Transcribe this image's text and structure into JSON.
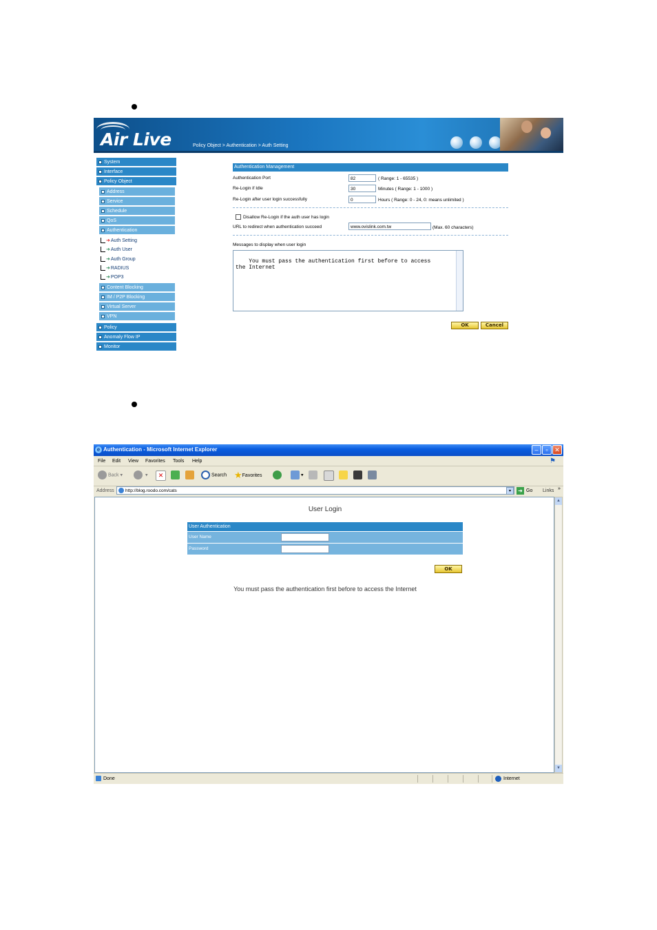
{
  "router_ui": {
    "logo": "Air Live",
    "breadcrumb": "Policy Object > Authentication > Auth Setting",
    "nav": {
      "system": "System",
      "interface": "Interface",
      "policy_object": "Policy Object",
      "address": "Address",
      "service": "Service",
      "schedule": "Schedule",
      "qos": "QoS",
      "authentication": "Authentication",
      "auth_setting": "Auth Setting",
      "auth_user": "Auth User",
      "auth_group": "Auth Group",
      "radius": "RADIUS",
      "pop3": "POP3",
      "content_blocking": "Content Blocking",
      "im_p2p_blocking": "IM / P2P Blocking",
      "virtual_server": "Virtual Server",
      "vpn": "VPN",
      "policy": "Policy",
      "anomaly_flow_ip": "Anomaly Flow IP",
      "monitor": "Monitor"
    },
    "section_title": "Authentication Management",
    "fields": {
      "auth_port_label": "Authentication Port",
      "auth_port_value": "82",
      "auth_port_hint": "( Range: 1 - 65535 )",
      "relogin_idle_label": "Re-Login if Idle",
      "relogin_idle_value": "30",
      "relogin_idle_hint": "Minutes  ( Range: 1 - 1000 )",
      "relogin_after_label": "Re-Login after user login successfully",
      "relogin_after_value": "0",
      "relogin_after_hint": "Hours  ( Range: 0 - 24, 0: means unlimited )",
      "disallow_label": "Disallow Re-Login if the auth user has login",
      "redirect_label": "URL to redirect when authentication succeed",
      "redirect_value": "www.ovislink.com.tw",
      "redirect_hint": "(Max. 60 characters)",
      "message_label": "Messages to display when user login",
      "message_value": "You must pass the authentication first before to access\nthe Internet"
    },
    "buttons": {
      "ok": "OK",
      "cancel": "Cancel"
    }
  },
  "browser": {
    "title": "Authentication - Microsoft Internet Explorer",
    "menu": [
      "File",
      "Edit",
      "View",
      "Favorites",
      "Tools",
      "Help"
    ],
    "toolbar": {
      "back": "Back",
      "search": "Search",
      "favorites": "Favorites"
    },
    "address_label": "Address",
    "address_value": "http://blog.roodo.com/cats",
    "go": "Go",
    "links": "Links",
    "page": {
      "title": "User Login",
      "table_title": "User Authentication",
      "username_label": "User Name",
      "password_label": "Password",
      "ok": "OK",
      "message": "You must pass the authentication first before to access the Internet"
    },
    "status": {
      "left": "Done",
      "zone": "Internet"
    }
  }
}
